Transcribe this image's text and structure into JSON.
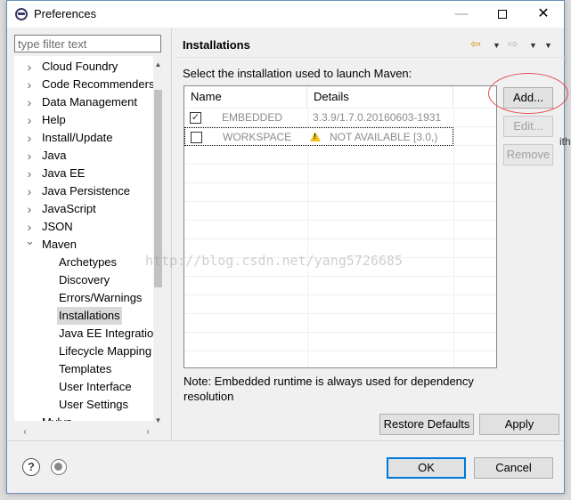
{
  "window": {
    "title": "Preferences"
  },
  "left_pane": {
    "filter_placeholder": "type filter text",
    "tree": [
      {
        "label": "Cloud Foundry",
        "level": 0,
        "expandable": true,
        "expanded": false
      },
      {
        "label": "Code Recommenders",
        "level": 0,
        "expandable": true,
        "expanded": false
      },
      {
        "label": "Data Management",
        "level": 0,
        "expandable": true,
        "expanded": false
      },
      {
        "label": "Help",
        "level": 0,
        "expandable": true,
        "expanded": false
      },
      {
        "label": "Install/Update",
        "level": 0,
        "expandable": true,
        "expanded": false
      },
      {
        "label": "Java",
        "level": 0,
        "expandable": true,
        "expanded": false
      },
      {
        "label": "Java EE",
        "level": 0,
        "expandable": true,
        "expanded": false
      },
      {
        "label": "Java Persistence",
        "level": 0,
        "expandable": true,
        "expanded": false
      },
      {
        "label": "JavaScript",
        "level": 0,
        "expandable": true,
        "expanded": false
      },
      {
        "label": "JSON",
        "level": 0,
        "expandable": true,
        "expanded": false
      },
      {
        "label": "Maven",
        "level": 0,
        "expandable": true,
        "expanded": true
      },
      {
        "label": "Archetypes",
        "level": 1,
        "expandable": false
      },
      {
        "label": "Discovery",
        "level": 1,
        "expandable": false
      },
      {
        "label": "Errors/Warnings",
        "level": 1,
        "expandable": false
      },
      {
        "label": "Installations",
        "level": 1,
        "expandable": false,
        "selected": true
      },
      {
        "label": "Java EE Integration",
        "level": 1,
        "expandable": false
      },
      {
        "label": "Lifecycle Mapping",
        "level": 1,
        "expandable": false
      },
      {
        "label": "Templates",
        "level": 1,
        "expandable": false
      },
      {
        "label": "User Interface",
        "level": 1,
        "expandable": false
      },
      {
        "label": "User Settings",
        "level": 1,
        "expandable": false
      },
      {
        "label": "Mylyn",
        "level": 0,
        "expandable": true,
        "expanded": false
      }
    ]
  },
  "page": {
    "title": "Installations",
    "select_label": "Select the installation used to launch Maven:",
    "table": {
      "columns": [
        "Name",
        "Details"
      ],
      "rows": [
        {
          "checked": true,
          "name": "EMBEDDED",
          "details": "3.3.9/1.7.0.20160603-1931",
          "warning": false
        },
        {
          "checked": false,
          "name": "WORKSPACE",
          "details": "NOT AVAILABLE [3.0,)",
          "warning": true,
          "selected": true
        }
      ]
    },
    "buttons": {
      "add": "Add...",
      "edit": "Edit...",
      "remove": "Remove"
    },
    "note": "Note: Embedded runtime is always used for dependency resolution",
    "restore_defaults": "Restore Defaults",
    "apply": "Apply"
  },
  "footer": {
    "ok": "OK",
    "cancel": "Cancel"
  },
  "edge_text": "ith",
  "watermark": "http://blog.csdn.net/yang5726685",
  "colors": {
    "accent": "#0078d7",
    "highlight_ring": "#e05050",
    "warning": "#f2c21b"
  }
}
